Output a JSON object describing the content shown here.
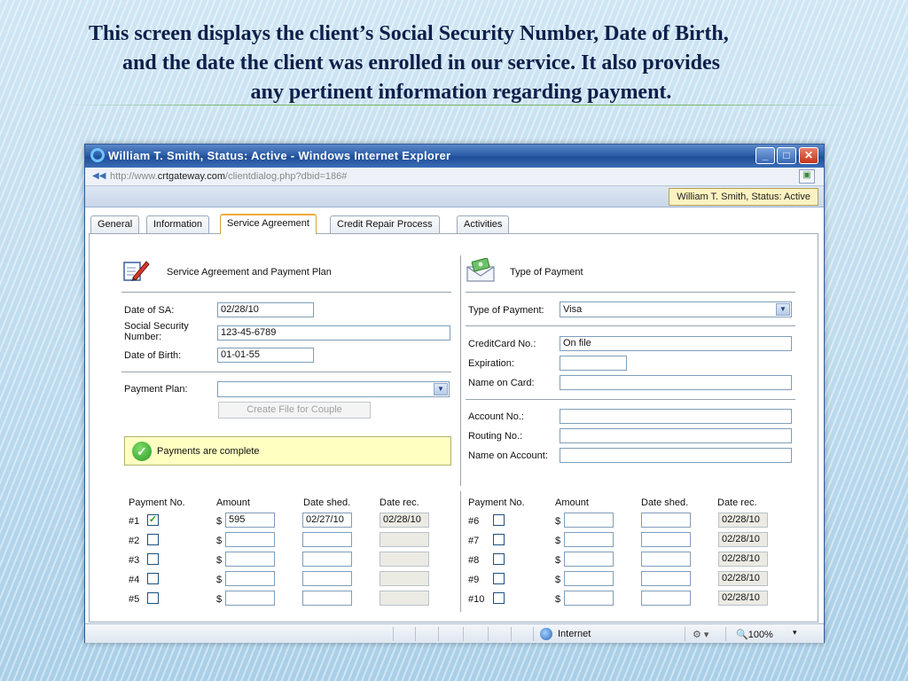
{
  "slide": {
    "heading_line1": "This screen displays the client’s Social Security Number, Date of Birth,",
    "heading_line2": "and the date the client was enrolled in our service.  It also provides",
    "heading_line3": "any pertinent information regarding payment."
  },
  "window": {
    "title": "William T. Smith, Status: Active - Windows Internet Explorer",
    "url_prefix": "http://www.",
    "url_domain": "crtgateway.com",
    "url_path": "/clientdialog.php?dbid=186#",
    "client_badge": "William T. Smith, Status: Active",
    "minimize_glyph": "_",
    "maximize_glyph": "□",
    "close_glyph": "✕"
  },
  "tabs": [
    {
      "label": "General"
    },
    {
      "label": "Information"
    },
    {
      "label": "Service Agreement",
      "active": true
    },
    {
      "label": "Credit Repair Process"
    },
    {
      "label": "Activities"
    }
  ],
  "service_agreement": {
    "section_title": "Service Agreement and Payment Plan",
    "date_of_sa_label": "Date of SA:",
    "date_of_sa_value": "02/28/10",
    "ssn_label_line1": "Social Security",
    "ssn_label_line2": "Number:",
    "ssn_value": "123-45-6789",
    "dob_label": "Date of Birth:",
    "dob_value": "01-01-55",
    "payment_plan_label": "Payment Plan:",
    "payment_plan_value": "",
    "create_file_button": "Create File for Couple",
    "notice_text": "Payments are complete"
  },
  "type_of_payment": {
    "section_title": "Type of Payment",
    "type_label": "Type of Payment:",
    "type_value": "Visa",
    "cc_label": "CreditCard No.:",
    "cc_value": "On file",
    "expiration_label": "Expiration:",
    "expiration_value": "",
    "name_on_card_label": "Name on Card:",
    "name_on_card_value": "",
    "account_label": "Account No.:",
    "account_value": "",
    "routing_label": "Routing No.:",
    "routing_value": "",
    "name_on_account_label": "Name on Account:",
    "name_on_account_value": ""
  },
  "payments_headers": {
    "payment_no": "Payment No.",
    "amount": "Amount",
    "date_shed": "Date shed.",
    "date_rec": "Date rec."
  },
  "payments_left": [
    {
      "no": "#1",
      "checked": true,
      "currency": "$",
      "amount": "595",
      "date_shed": "02/27/10",
      "date_rec": "02/28/10"
    },
    {
      "no": "#2",
      "checked": false,
      "currency": "$",
      "amount": "",
      "date_shed": "",
      "date_rec": ""
    },
    {
      "no": "#3",
      "checked": false,
      "currency": "$",
      "amount": "",
      "date_shed": "",
      "date_rec": ""
    },
    {
      "no": "#4",
      "checked": false,
      "currency": "$",
      "amount": "",
      "date_shed": "",
      "date_rec": ""
    },
    {
      "no": "#5",
      "checked": false,
      "currency": "$",
      "amount": "",
      "date_shed": "",
      "date_rec": ""
    }
  ],
  "payments_right": [
    {
      "no": "#6",
      "checked": false,
      "currency": "$",
      "amount": "",
      "date_shed": "",
      "date_rec": "02/28/10"
    },
    {
      "no": "#7",
      "checked": false,
      "currency": "$",
      "amount": "",
      "date_shed": "",
      "date_rec": "02/28/10"
    },
    {
      "no": "#8",
      "checked": false,
      "currency": "$",
      "amount": "",
      "date_shed": "",
      "date_rec": "02/28/10"
    },
    {
      "no": "#9",
      "checked": false,
      "currency": "$",
      "amount": "",
      "date_shed": "",
      "date_rec": "02/28/10"
    },
    {
      "no": "#10",
      "checked": false,
      "currency": "$",
      "amount": "",
      "date_shed": "",
      "date_rec": "02/28/10"
    }
  ],
  "statusbar": {
    "zone": "Internet",
    "security_glyph": "⚙ ▾",
    "zoom": "100%",
    "zoom_glyph": "▾"
  },
  "icons": {
    "window": "internet-explorer-icon",
    "page": "page-icon",
    "service_agreement": "edit-document-icon",
    "payment": "money-envelope-icon",
    "notice": "checkmark-icon",
    "zone": "globe-icon"
  },
  "colors": {
    "titlebar": "#2d5ea8",
    "active_tab_accent": "#f0a83b",
    "notice_background": "#ffffc2",
    "heading_text": "#0e1f4a"
  }
}
